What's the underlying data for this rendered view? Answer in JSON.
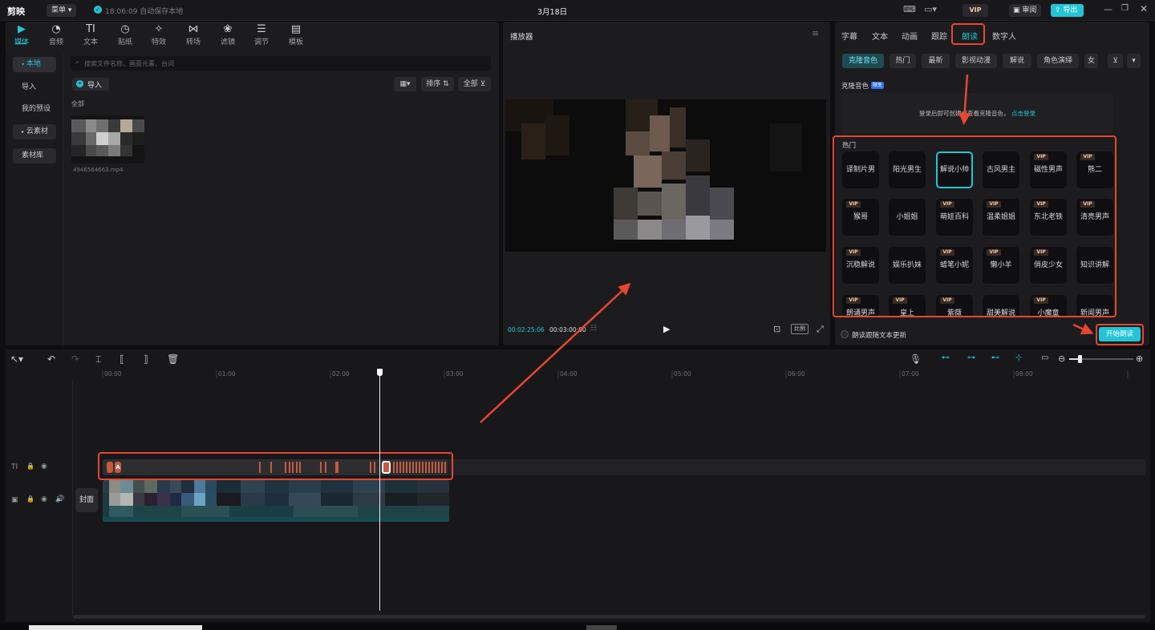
{
  "app": {
    "logo": "剪映",
    "menu": "菜单",
    "save_status": "18:06:09 自动保存本地",
    "title": "3月18日",
    "vip": "VIP",
    "review": "审阅",
    "export": "导出"
  },
  "toolbar": {
    "items": [
      {
        "label": "媒体",
        "icon": "media-icon"
      },
      {
        "label": "音频",
        "icon": "audio-icon"
      },
      {
        "label": "文本",
        "icon": "text-icon"
      },
      {
        "label": "贴纸",
        "icon": "sticker-icon"
      },
      {
        "label": "特效",
        "icon": "effects-icon"
      },
      {
        "label": "转场",
        "icon": "transition-icon"
      },
      {
        "label": "滤镜",
        "icon": "filter-icon"
      },
      {
        "label": "调节",
        "icon": "adjust-icon"
      },
      {
        "label": "模板",
        "icon": "template-icon"
      }
    ]
  },
  "media": {
    "sidebar": [
      "本地",
      "导入",
      "我的预设",
      "云素材",
      "素材库"
    ],
    "search_placeholder": "搜索文件名称、画面元素、台词",
    "import": "导入",
    "sort": "排序",
    "filter_all": "全部",
    "section": "全部",
    "file": "4946564663.mp4"
  },
  "player": {
    "title": "播放器",
    "time_current": "00:02:25:06",
    "time_total": "00:03:00:00",
    "ratio": "比例"
  },
  "right": {
    "tabs": [
      "字幕",
      "文本",
      "动画",
      "跟踪",
      "朗读",
      "数字人"
    ],
    "categories": [
      "克隆音色",
      "热门",
      "最新",
      "影视动漫",
      "解说",
      "角色演绎",
      "女"
    ],
    "clone_title": "克隆音色",
    "clone_badge": "限免",
    "clone_hint": "登录后即可创建或查看克隆音色，",
    "clone_link": "点击登录",
    "hot_title": "热门",
    "voices": [
      "译制片男",
      "阳光男生",
      "解说小帅",
      "古风男主",
      "磁性男声",
      "熊二",
      "猴哥",
      "小姐姐",
      "萌娃百科",
      "温柔姐姐",
      "东北老铁",
      "清亮男声",
      "沉稳解说",
      "娱乐扒妹",
      "蜡笔小妮",
      "懒小羊",
      "俏皮少女",
      "知识讲解",
      "朗诵男声",
      "皇上",
      "紫薇",
      "甜美解说",
      "小魔童",
      "新闻男声"
    ],
    "follow_text": "朗读跟随文本更新",
    "start_button": "开始朗读"
  },
  "timeline": {
    "ticks": [
      "00:00",
      "01:00",
      "02:00",
      "03:00",
      "04:00",
      "05:00",
      "06:00",
      "07:00",
      "08:00"
    ],
    "text_track_label": "TI",
    "cover": "封面",
    "clip_letter": "A"
  }
}
